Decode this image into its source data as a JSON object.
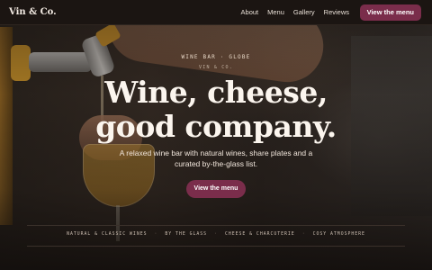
{
  "brand": {
    "logo": "Vin & Co."
  },
  "nav": {
    "links": [
      "About",
      "Menu",
      "Gallery",
      "Reviews"
    ],
    "cta_label": "View the menu"
  },
  "hero": {
    "eyebrow": "WINE BAR · GLOBE",
    "eyebrow_secondary": "VIN & CO.",
    "headline_line1": "Wine, cheese,",
    "headline_line2": "good company.",
    "subtitle": "A relaxed wine bar with natural wines, share plates and a curated by-the-glass list.",
    "cta_label": "View the menu"
  },
  "features": {
    "items": [
      "NATURAL & CLASSIC WINES",
      "BY THE GLASS",
      "CHEESE & CHARCUTERIE",
      "COSY ATMOSPHERE"
    ],
    "separator": "·"
  },
  "colors": {
    "accent": "#7a2d4b",
    "background": "#161210"
  }
}
